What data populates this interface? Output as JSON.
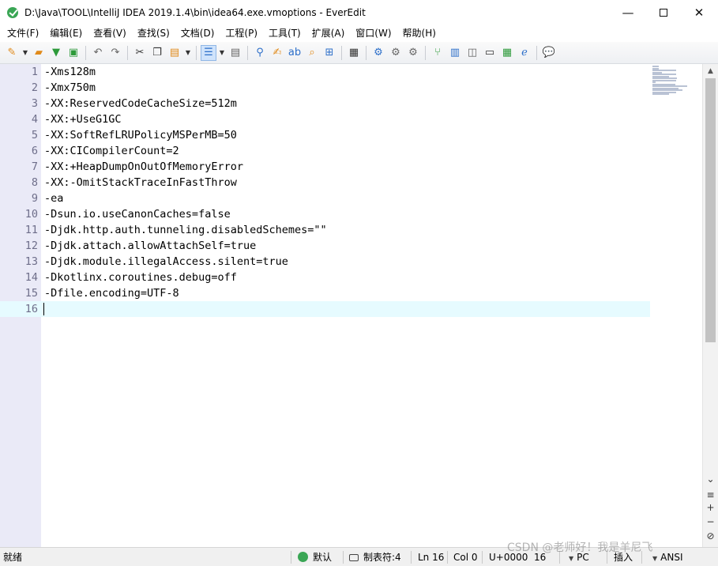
{
  "window": {
    "title": "D:\\Java\\TOOL\\IntelliJ IDEA 2019.1.4\\bin\\idea64.exe.vmoptions - EverEdit",
    "minimize": "—",
    "close": "✕"
  },
  "menu": [
    "文件(F)",
    "编辑(E)",
    "查看(V)",
    "查找(S)",
    "文档(D)",
    "工程(P)",
    "工具(T)",
    "扩展(A)",
    "窗口(W)",
    "帮助(H)"
  ],
  "toolbar_icons": {
    "new": "new-file-icon",
    "open": "open-folder-icon",
    "save": "save-icon",
    "save_all": "save-all-icon",
    "undo": "undo-icon",
    "redo": "redo-icon",
    "cut": "cut-icon",
    "copy": "copy-icon",
    "paste": "paste-icon",
    "wrap": "word-wrap-icon",
    "column": "column-mode-icon",
    "find": "find-icon",
    "replace": "replace-icon",
    "find_files": "find-in-files-icon",
    "browser": "browser-icon",
    "settings": "settings-icon",
    "help": "help-icon"
  },
  "editor": {
    "current_line": 16,
    "lines": [
      {
        "n": "1",
        "text": "-Xms128m"
      },
      {
        "n": "2",
        "text": "-Xmx750m"
      },
      {
        "n": "3",
        "text": "-XX:ReservedCodeCacheSize=512m"
      },
      {
        "n": "4",
        "text": "-XX:+UseG1GC"
      },
      {
        "n": "5",
        "text": "-XX:SoftRefLRUPolicyMSPerMB=50"
      },
      {
        "n": "6",
        "text": "-XX:CICompilerCount=2"
      },
      {
        "n": "7",
        "text": "-XX:+HeapDumpOnOutOfMemoryError"
      },
      {
        "n": "8",
        "text": "-XX:-OmitStackTraceInFastThrow"
      },
      {
        "n": "9",
        "text": "-ea"
      },
      {
        "n": "10",
        "text": "-Dsun.io.useCanonCaches=false"
      },
      {
        "n": "11",
        "text": "-Djdk.http.auth.tunneling.disabledSchemes=\"\""
      },
      {
        "n": "12",
        "text": "-Djdk.attach.allowAttachSelf=true"
      },
      {
        "n": "13",
        "text": "-Djdk.module.illegalAccess.silent=true"
      },
      {
        "n": "14",
        "text": "-Dkotlinx.coroutines.debug=off"
      },
      {
        "n": "15",
        "text": "-Dfile.encoding=UTF-8"
      },
      {
        "n": "16",
        "text": ""
      }
    ]
  },
  "scrollbar": {
    "up": "▲",
    "down": "⌄",
    "plus": "+",
    "minus": "−",
    "circle": "⊘"
  },
  "status": {
    "ready": "就绪",
    "scheme": "默认",
    "tab": "制表符:4",
    "line": "Ln 16",
    "col": "Col 0",
    "unicode": "U+0000",
    "font_size": "16",
    "eol": "PC",
    "mode": "插入",
    "encoding": "ANSI"
  },
  "watermark": "CSDN @老师好！我是羊尼飞"
}
